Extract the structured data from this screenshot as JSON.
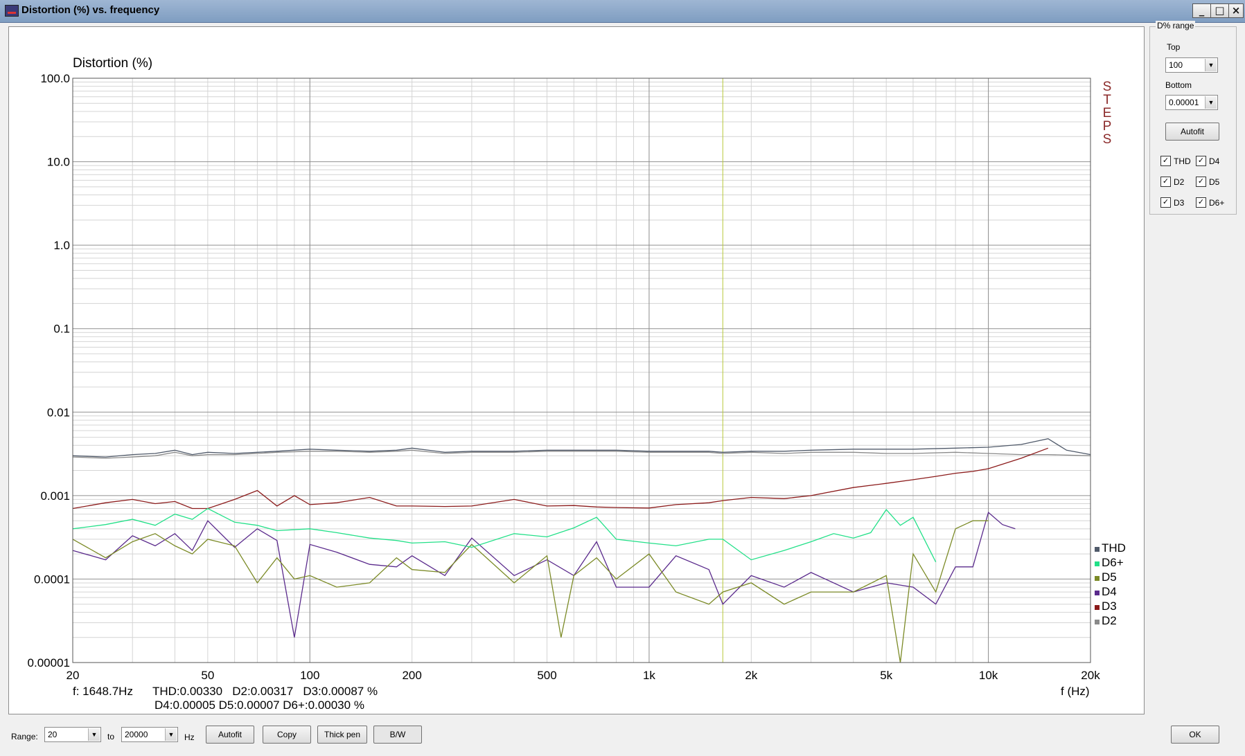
{
  "window": {
    "title": "Distortion (%) vs. frequency",
    "minimize_glyph": "_",
    "maximize_glyph": "□",
    "close_glyph": "×"
  },
  "readout": {
    "line1": "f: 1648.7Hz      THD:0.00330   D2:0.00317   D3:0.00087 %",
    "line2": "D4:0.00005   D5:0.00007   D6+:0.00030 %"
  },
  "steps_label": [
    "S",
    "T",
    "E",
    "P",
    "S"
  ],
  "side_panel": {
    "group_title": "D% range",
    "top_label": "Top",
    "top_value": "100",
    "bottom_label": "Bottom",
    "bottom_value": "0.00001",
    "autofit_label": "Autofit",
    "checkboxes": [
      {
        "label": "THD",
        "checked": true
      },
      {
        "label": "D4",
        "checked": true
      },
      {
        "label": "D2",
        "checked": true
      },
      {
        "label": "D5",
        "checked": true
      },
      {
        "label": "D3",
        "checked": true
      },
      {
        "label": "D6+",
        "checked": true
      }
    ]
  },
  "bottom_bar": {
    "range_label": "Range:",
    "range_from": "20",
    "to_label": "to",
    "range_to": "20000",
    "unit_label": "Hz",
    "autofit_label": "Autofit",
    "copy_label": "Copy",
    "thick_pen_label": "Thick pen",
    "bw_label": "B/W",
    "ok_label": "OK"
  },
  "chart_data": {
    "type": "line",
    "ylabel": "Distortion (%)",
    "xlabel": "f (Hz)",
    "x_scale": "log",
    "y_scale": "log",
    "xlim": [
      20,
      20000
    ],
    "ylim": [
      1e-05,
      100
    ],
    "x_ticks": [
      20,
      50,
      100,
      200,
      500,
      1000,
      2000,
      5000,
      10000,
      20000
    ],
    "x_tick_labels": [
      "20",
      "50",
      "100",
      "200",
      "500",
      "1k",
      "2k",
      "5k",
      "10k",
      "20k"
    ],
    "y_ticks": [
      100,
      10,
      1,
      0.1,
      0.01,
      0.001,
      0.0001,
      1e-05
    ],
    "y_tick_labels": [
      "100.0",
      "10.0",
      "1.0",
      "0.1",
      "0.01",
      "0.001",
      "0.0001",
      "0.00001"
    ],
    "grid": true,
    "cursor_frequency": 1648.7,
    "legend_position": "bottom-right",
    "series": [
      {
        "name": "THD",
        "color": "#505a6a",
        "x": [
          20,
          25,
          30,
          35,
          40,
          45,
          50,
          60,
          70,
          80,
          100,
          120,
          150,
          180,
          200,
          250,
          300,
          400,
          500,
          600,
          800,
          1000,
          1200,
          1500,
          1648.7,
          2000,
          2500,
          3000,
          4000,
          5000,
          6000,
          8000,
          10000,
          12500,
          15000,
          17000,
          20000
        ],
        "values": [
          0.003,
          0.0029,
          0.0031,
          0.0032,
          0.0035,
          0.0031,
          0.0033,
          0.0032,
          0.0033,
          0.0034,
          0.0036,
          0.0035,
          0.0034,
          0.0035,
          0.0037,
          0.0033,
          0.0034,
          0.0034,
          0.0035,
          0.0035,
          0.0035,
          0.0034,
          0.0034,
          0.0034,
          0.0033,
          0.0034,
          0.0034,
          0.0035,
          0.0036,
          0.0036,
          0.0036,
          0.0037,
          0.0038,
          0.0041,
          0.0048,
          0.0035,
          0.0031
        ]
      },
      {
        "name": "D6+",
        "color": "#22e088",
        "x": [
          20,
          25,
          30,
          35,
          40,
          45,
          50,
          60,
          70,
          80,
          100,
          120,
          150,
          180,
          200,
          250,
          300,
          400,
          500,
          600,
          700,
          800,
          1000,
          1200,
          1500,
          1648.7,
          2000,
          2500,
          3000,
          3500,
          4000,
          4500,
          5000,
          5500,
          6000,
          7000
        ],
        "values": [
          0.0004,
          0.00045,
          0.00052,
          0.00044,
          0.0006,
          0.00052,
          0.0007,
          0.00048,
          0.00044,
          0.00038,
          0.0004,
          0.00036,
          0.00031,
          0.00029,
          0.00027,
          0.00028,
          0.00024,
          0.00035,
          0.00032,
          0.00041,
          0.00055,
          0.0003,
          0.00027,
          0.00025,
          0.0003,
          0.0003,
          0.00017,
          0.00022,
          0.00028,
          0.00035,
          0.00031,
          0.00036,
          0.00068,
          0.00044,
          0.00055,
          0.00016
        ]
      },
      {
        "name": "D5",
        "color": "#7b8a26",
        "x": [
          20,
          25,
          30,
          35,
          40,
          45,
          50,
          60,
          70,
          80,
          90,
          100,
          120,
          150,
          180,
          200,
          250,
          300,
          400,
          500,
          550,
          600,
          700,
          800,
          1000,
          1200,
          1500,
          1648.7,
          2000,
          2500,
          3000,
          4000,
          5000,
          5500,
          6000,
          7000,
          8000,
          9000,
          10000
        ],
        "values": [
          0.0003,
          0.00018,
          0.00028,
          0.00035,
          0.00025,
          0.0002,
          0.0003,
          0.00025,
          9e-05,
          0.00018,
          0.0001,
          0.00011,
          8e-05,
          9e-05,
          0.00018,
          0.00013,
          0.00012,
          0.00026,
          9e-05,
          0.00019,
          2e-05,
          0.00011,
          0.00018,
          0.0001,
          0.0002,
          7e-05,
          5e-05,
          7e-05,
          9e-05,
          5e-05,
          7e-05,
          7e-05,
          0.00011,
          1e-05,
          0.0002,
          7e-05,
          0.0004,
          0.0005,
          0.0005
        ]
      },
      {
        "name": "D4",
        "color": "#5a2a8c",
        "x": [
          20,
          25,
          30,
          35,
          40,
          45,
          50,
          60,
          70,
          80,
          90,
          100,
          120,
          150,
          180,
          200,
          250,
          300,
          400,
          500,
          600,
          700,
          800,
          1000,
          1200,
          1500,
          1648.7,
          2000,
          2500,
          3000,
          4000,
          5000,
          6000,
          7000,
          8000,
          9000,
          10000,
          11000,
          12000
        ],
        "values": [
          0.00022,
          0.00017,
          0.00033,
          0.00025,
          0.00035,
          0.00022,
          0.0005,
          0.00024,
          0.0004,
          0.00029,
          2e-05,
          0.00026,
          0.00021,
          0.00015,
          0.00014,
          0.00019,
          0.00011,
          0.00031,
          0.00011,
          0.00017,
          0.00011,
          0.00028,
          8e-05,
          8e-05,
          0.00019,
          0.00013,
          5e-05,
          0.00011,
          8e-05,
          0.00012,
          7e-05,
          9e-05,
          8e-05,
          5e-05,
          0.00014,
          0.00014,
          0.00063,
          0.00045,
          0.0004
        ]
      },
      {
        "name": "D3",
        "color": "#8b1a1a",
        "x": [
          20,
          25,
          30,
          35,
          40,
          45,
          50,
          60,
          70,
          80,
          90,
          100,
          120,
          150,
          180,
          200,
          250,
          300,
          400,
          500,
          600,
          700,
          800,
          1000,
          1200,
          1500,
          1648.7,
          2000,
          2500,
          3000,
          4000,
          5000,
          6000,
          7000,
          8000,
          9000,
          10000,
          12500,
          15000
        ],
        "values": [
          0.0007,
          0.00082,
          0.0009,
          0.0008,
          0.00085,
          0.0007,
          0.0007,
          0.0009,
          0.00115,
          0.00075,
          0.001,
          0.00078,
          0.00082,
          0.00095,
          0.00075,
          0.00075,
          0.00074,
          0.00075,
          0.0009,
          0.00075,
          0.00076,
          0.00073,
          0.00072,
          0.00071,
          0.00078,
          0.00082,
          0.00087,
          0.00095,
          0.00092,
          0.001,
          0.00125,
          0.0014,
          0.00155,
          0.0017,
          0.00185,
          0.00195,
          0.0021,
          0.0028,
          0.0037
        ]
      },
      {
        "name": "D2",
        "color": "#8a8a8a",
        "x": [
          20,
          25,
          30,
          35,
          40,
          45,
          50,
          60,
          70,
          80,
          100,
          120,
          150,
          180,
          200,
          250,
          300,
          400,
          500,
          600,
          800,
          1000,
          1200,
          1500,
          1648.7,
          2000,
          2500,
          3000,
          4000,
          5000,
          6000,
          8000,
          10000,
          12500,
          15000,
          20000
        ],
        "values": [
          0.0029,
          0.0028,
          0.0029,
          0.003,
          0.0033,
          0.003,
          0.0031,
          0.0031,
          0.0032,
          0.0033,
          0.0034,
          0.0034,
          0.0033,
          0.0034,
          0.0035,
          0.0032,
          0.0033,
          0.0033,
          0.0034,
          0.0034,
          0.0034,
          0.0033,
          0.0033,
          0.0033,
          0.0032,
          0.0033,
          0.0032,
          0.0033,
          0.0033,
          0.0032,
          0.0032,
          0.0033,
          0.0032,
          0.0031,
          0.0031,
          0.003
        ]
      }
    ]
  }
}
